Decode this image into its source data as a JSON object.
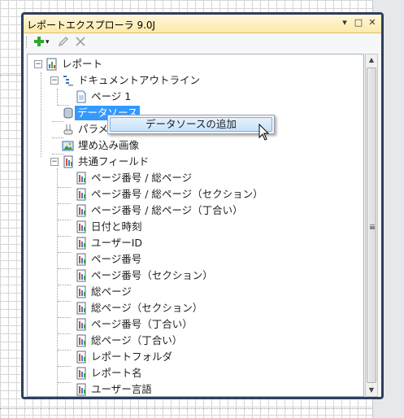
{
  "window": {
    "title": "レポートエクスプローラ 9.0J",
    "buttons": {
      "dropdown": "▾",
      "maximize": "□",
      "close": "✕"
    }
  },
  "toolbar": {
    "add_icon": "plus-icon",
    "add_dropdown": "▾",
    "edit_icon": "pencil-icon",
    "delete_icon": "delete-x-icon",
    "accent_add": "#2fa82f"
  },
  "tree": {
    "root": {
      "label": "レポート",
      "icon": "report-icon",
      "expanded": true
    },
    "document_outline": {
      "label": "ドキュメントアウトライン",
      "icon": "outline-icon",
      "expanded": true
    },
    "page1": {
      "label": "ページ 1",
      "icon": "page-icon"
    },
    "datasource": {
      "label": "データソース",
      "icon": "datasource-icon",
      "selected": true
    },
    "parameters": {
      "label": "パラメ",
      "icon": "parameter-icon"
    },
    "embedded_images": {
      "label": "埋め込み画像",
      "icon": "image-icon"
    },
    "common_fields": {
      "label": "共通フィールド",
      "icon": "fields-icon",
      "expanded": true,
      "items": [
        "ページ番号 / 総ページ",
        "ページ番号 / 総ページ（セクション）",
        "ページ番号 / 総ページ（丁合い）",
        "日付と時刻",
        "ユーザーID",
        "ページ番号",
        "ページ番号（セクション）",
        "総ページ",
        "総ページ（セクション）",
        "ページ番号（丁合い）",
        "総ページ（丁合い）",
        "レポートフォルダ",
        "レポート名",
        "ユーザー言語"
      ]
    }
  },
  "context_menu": {
    "items": [
      "データソースの追加"
    ]
  },
  "scrollbar": {
    "up": "▲",
    "down": "▼"
  },
  "colors": {
    "selection": "#3399ff",
    "title_bar": "#fde9a8",
    "frame": "#2e3f5c"
  }
}
